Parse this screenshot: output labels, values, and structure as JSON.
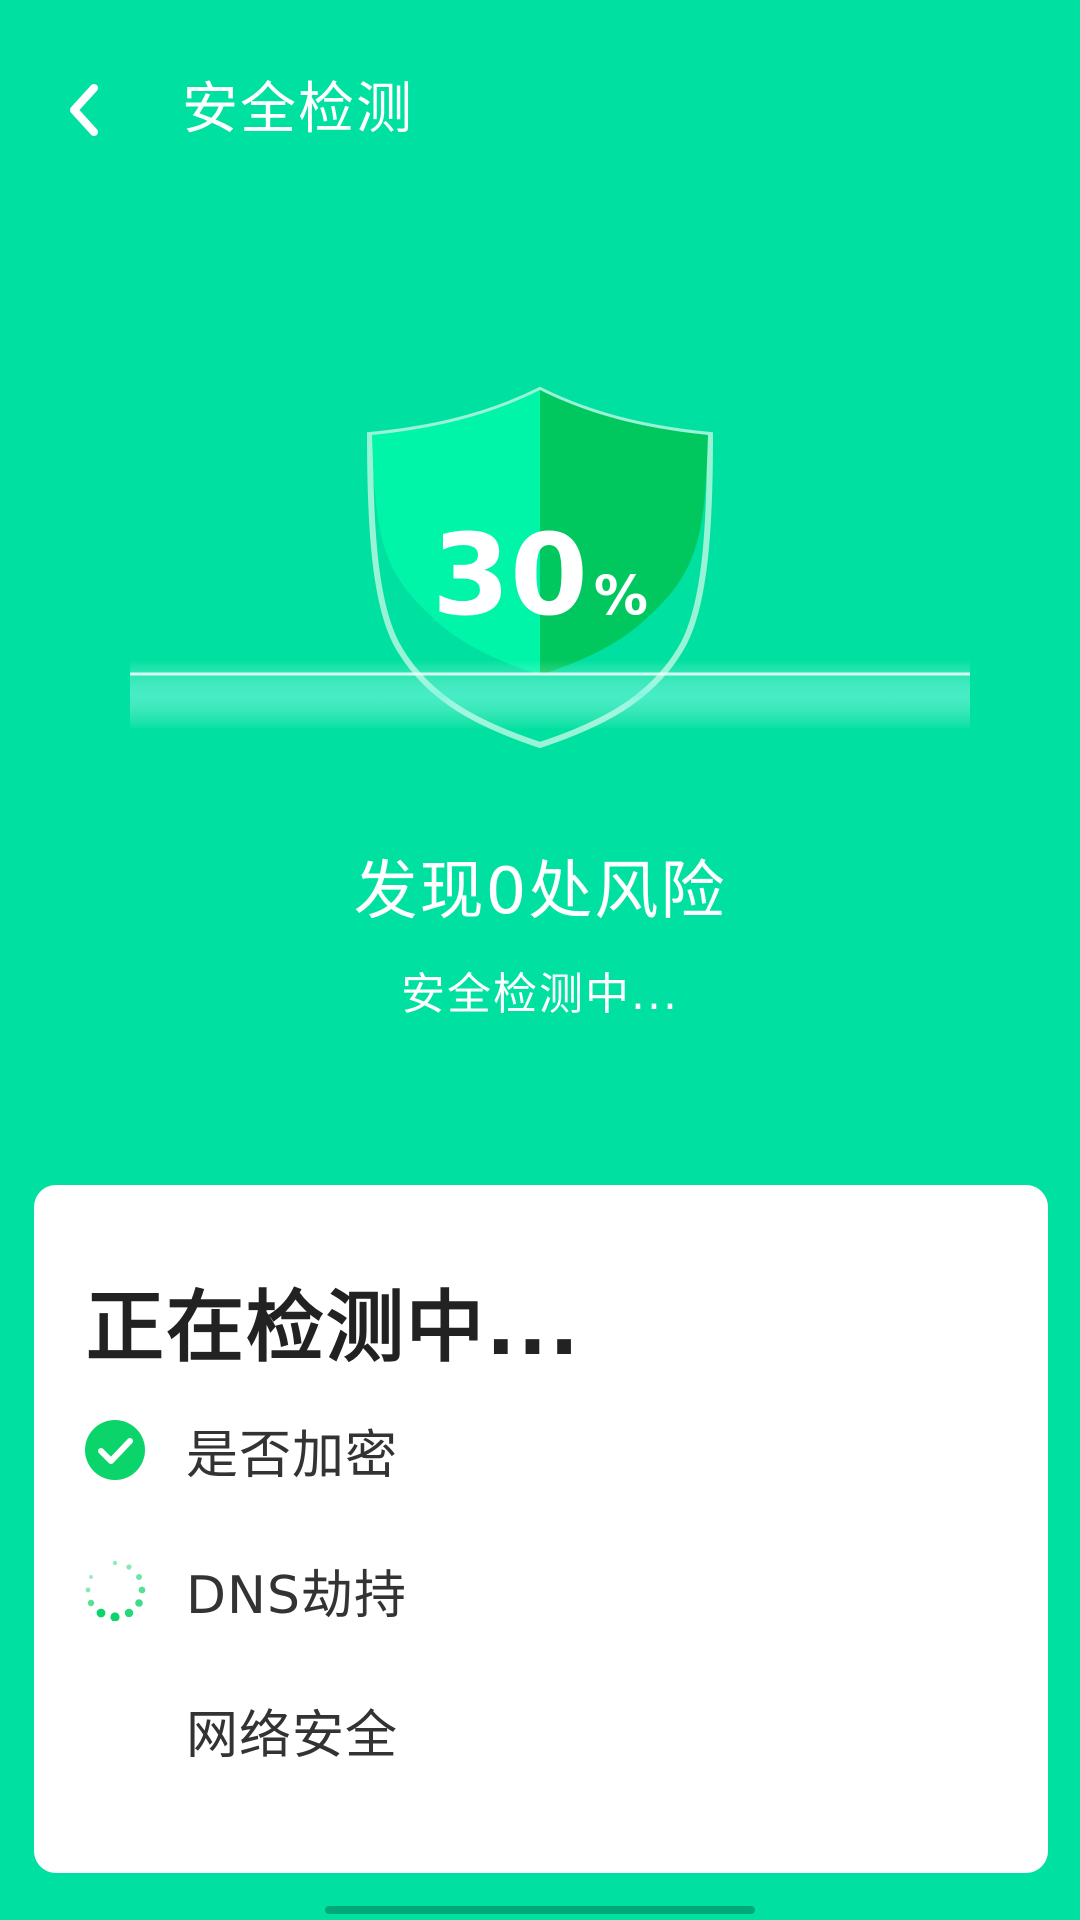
{
  "header": {
    "title": "安全检测",
    "back_icon": "chevron-left-icon"
  },
  "scan": {
    "progress_number": "30",
    "progress_unit": "%",
    "progress_fraction": 0.3,
    "risk_summary": "发现0处风险",
    "status": "安全检测中..."
  },
  "card": {
    "title": "正在检测中...",
    "items": [
      {
        "label": "是否加密",
        "state": "done",
        "icon": "check-circle-icon"
      },
      {
        "label": "DNS劫持",
        "state": "loading",
        "icon": "spinner-icon"
      },
      {
        "label": "网络安全",
        "state": "pending",
        "icon": ""
      }
    ]
  },
  "colors": {
    "background": "#00e0a0",
    "shield_light": "#00f5a8",
    "shield_dark": "#00c85f",
    "check_green": "#0bd46a",
    "card_bg": "#ffffff",
    "text_dark": "#222222"
  }
}
